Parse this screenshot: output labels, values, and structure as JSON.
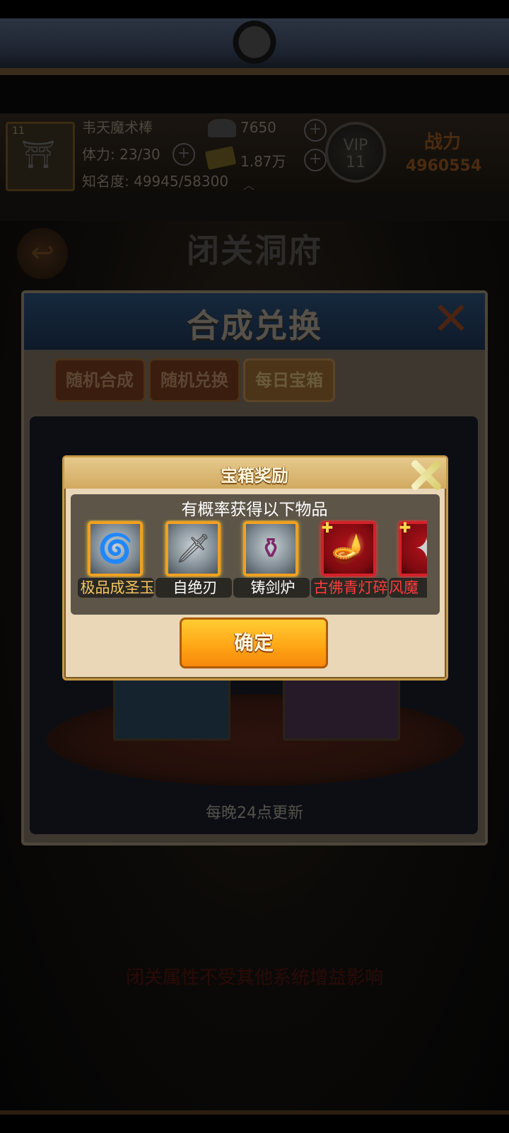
{
  "background": {
    "player": {
      "name": "韦天魔术棒",
      "stamina": "体力: 23/30",
      "fame": "知名度: 49945/58300",
      "silver": "7650",
      "gold": "1.87万",
      "vip_label": "VIP",
      "vip_level": "11",
      "power_label": "战力",
      "power_value": "4960554"
    },
    "scene_title": "闭关洞府",
    "bottom_notice": "闭关属性不受其他系统增益影响"
  },
  "synthesis_panel": {
    "title": "合成兑换",
    "tabs": [
      {
        "label": "随机合成"
      },
      {
        "label": "随机兑换"
      },
      {
        "label": "每日宝箱"
      }
    ],
    "refresh_note": "每晚24点更新"
  },
  "reward_dialog": {
    "title": "宝箱奖励",
    "subtitle": "有概率获得以下物品",
    "items": [
      {
        "name": "极品成圣玉",
        "icon": "jade-swirl-icon",
        "rarity_color": "#f4c560"
      },
      {
        "name": "自绝刃",
        "icon": "blade-icon",
        "rarity_color": "#ffffff"
      },
      {
        "name": "铸剑炉",
        "icon": "furnace-icon",
        "rarity_color": "#ffffff"
      },
      {
        "name": "古佛青灯碎",
        "icon": "oil-lamp-fragment-icon",
        "rarity_color": "#ff3b3b"
      },
      {
        "name": "风魔",
        "icon": "wind-demon-fragment-icon",
        "rarity_color": "#ff3b3b"
      }
    ],
    "confirm_label": "确定"
  }
}
